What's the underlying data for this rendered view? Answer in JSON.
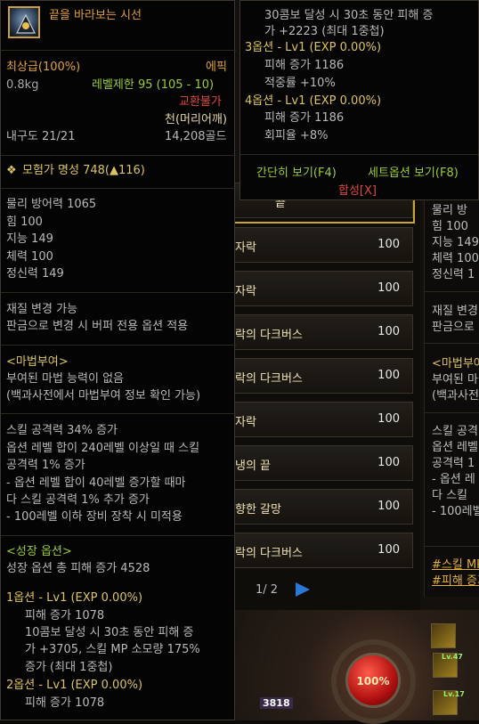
{
  "item": {
    "name": "끝을 바라보는 시선",
    "grade": "최상급(100%)",
    "rarity": "에픽",
    "weight": "0.8kg",
    "level_limit": "레벨제한 95 (105 - 10)",
    "trade": "교환불가",
    "slot": "천(머리어깨)",
    "durability": "내구도 21/21",
    "price": "14,208골드",
    "fame": "모험가 명성 748(▲116)",
    "stats": [
      "물리 방어력 1065",
      "힘 100",
      "지능 149",
      "체력 100",
      "정신력 149"
    ],
    "material_change": [
      "재질 변경 가능",
      "판금으로 변경 시 버퍼 전용 옵션 적용"
    ],
    "magic_header": "<마법부여>",
    "magic_lines": [
      "부여된 마법 능력이 없음",
      "(백과사전에서 마법부여 정보 확인 가능)"
    ],
    "skill_lines": [
      "스킬 공격력 34% 증가",
      "옵션 레벨 합이 240레벨 이상일 때 스킬",
      "공격력 1% 증가",
      "- 옵션 레벨 합이 40레벨 증가할 때마",
      "다 스킬 공격력 1% 추가 증가",
      "- 100레벨 이하 장비 장착 시 미적용"
    ],
    "growth_header": "<성장 옵션>",
    "growth_total": "성장 옵션 총 피해 증가 4528",
    "opt1_title": "1옵션 - Lv1 (EXP 0.00%)",
    "opt1_lines": [
      "피해 증가 1078",
      "10콤보 달성 시 30초 동안 피해 증",
      "가 +3705, 스킬 MP 소모량 175%",
      "증가 (최대 1중첩)"
    ],
    "opt2_title": "2옵션 - Lv1 (EXP 0.00%)",
    "opt2_lines": [
      "피해 증가 1078"
    ]
  },
  "tooltip_right": {
    "cont_line1": "30콤보 달성 시 30초 동안 피해 증",
    "cont_line2": "가 +2223 (최대 1중첩)",
    "opt3_title": "3옵션 - Lv1 (EXP 0.00%)",
    "opt3_lines": [
      "피해 증가 1186",
      "적중률 +10%"
    ],
    "opt4_title": "4옵션 - Lv1 (EXP 0.00%)",
    "opt4_lines": [
      "피해 증가 1186",
      "회피율 +8%"
    ],
    "simple_view": "간단히 보기(F4)",
    "set_option_view": "세트옵션 보기(F8)",
    "combine": "합성[X]"
  },
  "list": {
    "rows": [
      {
        "name": "끝",
        "count": "100"
      },
      {
        "name": "자락",
        "count": "100"
      },
      {
        "name": "자락",
        "count": "100"
      },
      {
        "name": "락의 다크버스",
        "count": "100"
      },
      {
        "name": "락의 다크버스",
        "count": "100"
      },
      {
        "name": "자락",
        "count": "100"
      },
      {
        "name": "냉의 끝",
        "count": "100"
      },
      {
        "name": " 향한 갈망",
        "count": "100"
      },
      {
        "name": "락의 다크버스",
        "count": "100"
      }
    ],
    "page": "1/ 2"
  },
  "right_panel": {
    "lines": [
      "물리 방",
      "힘 100",
      "지능 149",
      "체력 100",
      "정신력 1"
    ],
    "material": [
      "재질 변경",
      "판금으로"
    ],
    "magic_header": "<마법부여",
    "magic": [
      "부여된 마",
      "(백과사전"
    ],
    "skill": [
      "스킬 공격",
      "옵션 레벨",
      "공격력 1",
      "- 옵션 레",
      "다 스킬",
      "- 100레벨"
    ],
    "tags": [
      "#스킬 MP",
      "#피해 증가"
    ]
  },
  "hud": {
    "hp": "100%",
    "mp": "3818",
    "lv1": "Lv.47",
    "lv2": "Lv.17"
  }
}
